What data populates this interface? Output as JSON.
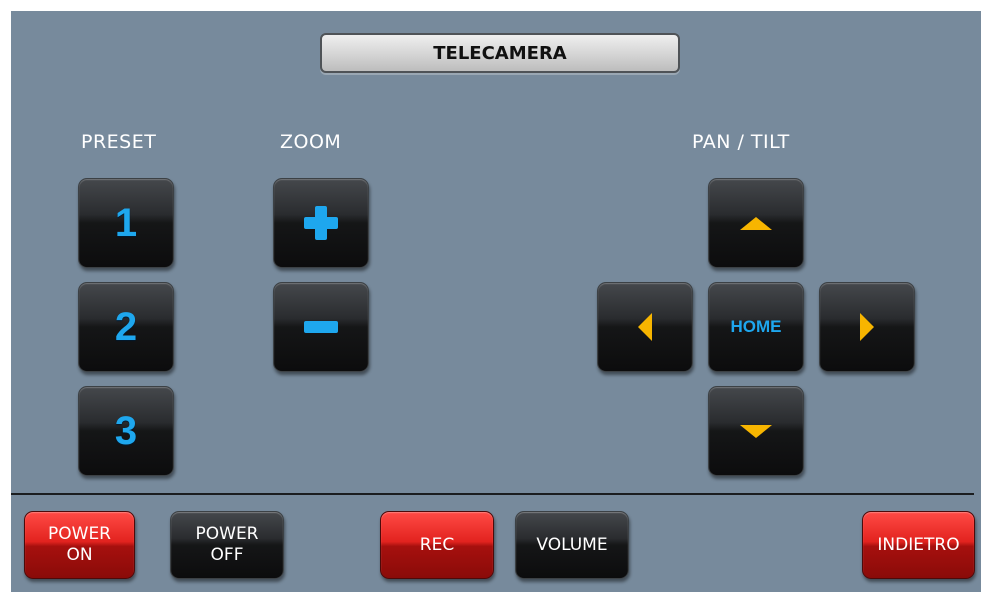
{
  "title": "TELECAMERA",
  "sections": {
    "preset": "PRESET",
    "zoom": "ZOOM",
    "pan_tilt": "PAN / TILT"
  },
  "preset_buttons": [
    "1",
    "2",
    "3"
  ],
  "pan_tilt": {
    "home_label": "HOME"
  },
  "bottom_bar": {
    "power_on": [
      "POWER",
      "ON"
    ],
    "power_off": [
      "POWER",
      "OFF"
    ],
    "rec": "REC",
    "volume": "VOLUME",
    "back": "INDIETRO"
  },
  "icons": {
    "zoom_in": "plus-icon",
    "zoom_out": "minus-icon",
    "up": "arrow-up-icon",
    "down": "arrow-down-icon",
    "left": "arrow-left-icon",
    "right": "arrow-right-icon"
  },
  "colors": {
    "panel_bg": "#778a9c",
    "accent_blue": "#1ea7ee",
    "arrow_yellow": "#f7b500",
    "button_red": "#e2231f",
    "button_black": "#151617"
  }
}
